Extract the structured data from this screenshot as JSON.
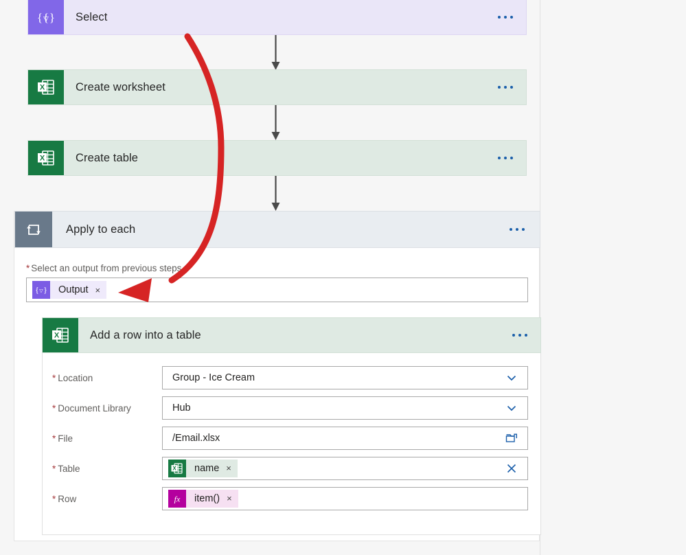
{
  "flow": {
    "steps": [
      {
        "title": "Select",
        "icon": "select-variable-icon",
        "theme": "purple",
        "menu": "more-commands"
      },
      {
        "title": "Create worksheet",
        "icon": "excel-icon",
        "theme": "green",
        "menu": "more-commands"
      },
      {
        "title": "Create table",
        "icon": "excel-icon",
        "theme": "green",
        "menu": "more-commands"
      }
    ]
  },
  "apply_to_each": {
    "title": "Apply to each",
    "icon": "loop-icon",
    "menu": "more-commands",
    "output_field": {
      "label": "Select an output from previous steps",
      "required_marker": "*",
      "token": {
        "text": "Output",
        "icon": "select-variable-icon",
        "remove": "×"
      }
    },
    "action": {
      "title": "Add a row into a table",
      "icon": "excel-icon",
      "menu": "more-commands",
      "fields": [
        {
          "label": "Location",
          "required_marker": "*",
          "value": "Group - Ice Cream",
          "control": "chevron-down-icon",
          "type": "dropdown"
        },
        {
          "label": "Document Library",
          "required_marker": "*",
          "value": "Hub",
          "control": "chevron-down-icon",
          "type": "dropdown"
        },
        {
          "label": "File",
          "required_marker": "*",
          "value": "/Email.xlsx",
          "control": "folder-icon",
          "type": "file-picker"
        },
        {
          "label": "Table",
          "required_marker": "*",
          "token": {
            "text": "name",
            "icon": "excel-icon",
            "theme": "green",
            "remove": "×"
          },
          "control": "close-icon",
          "type": "token"
        },
        {
          "label": "Row",
          "required_marker": "*",
          "token": {
            "text": "item()",
            "icon": "function-icon",
            "theme": "pink",
            "remove": "×"
          },
          "control": "none",
          "type": "token"
        }
      ]
    }
  },
  "annotation": {
    "type": "curved-arrow",
    "color": "#d62424",
    "points_to": "output-token"
  },
  "colors": {
    "purple_accent": "#8167e8",
    "green_accent": "#177a43",
    "gray_accent": "#69798a",
    "pink_accent": "#b4009e",
    "link_blue": "#1b5faa",
    "required_red": "#a4373a",
    "annotation_red": "#d62424",
    "canvas_bg": "#f6f6f6"
  }
}
